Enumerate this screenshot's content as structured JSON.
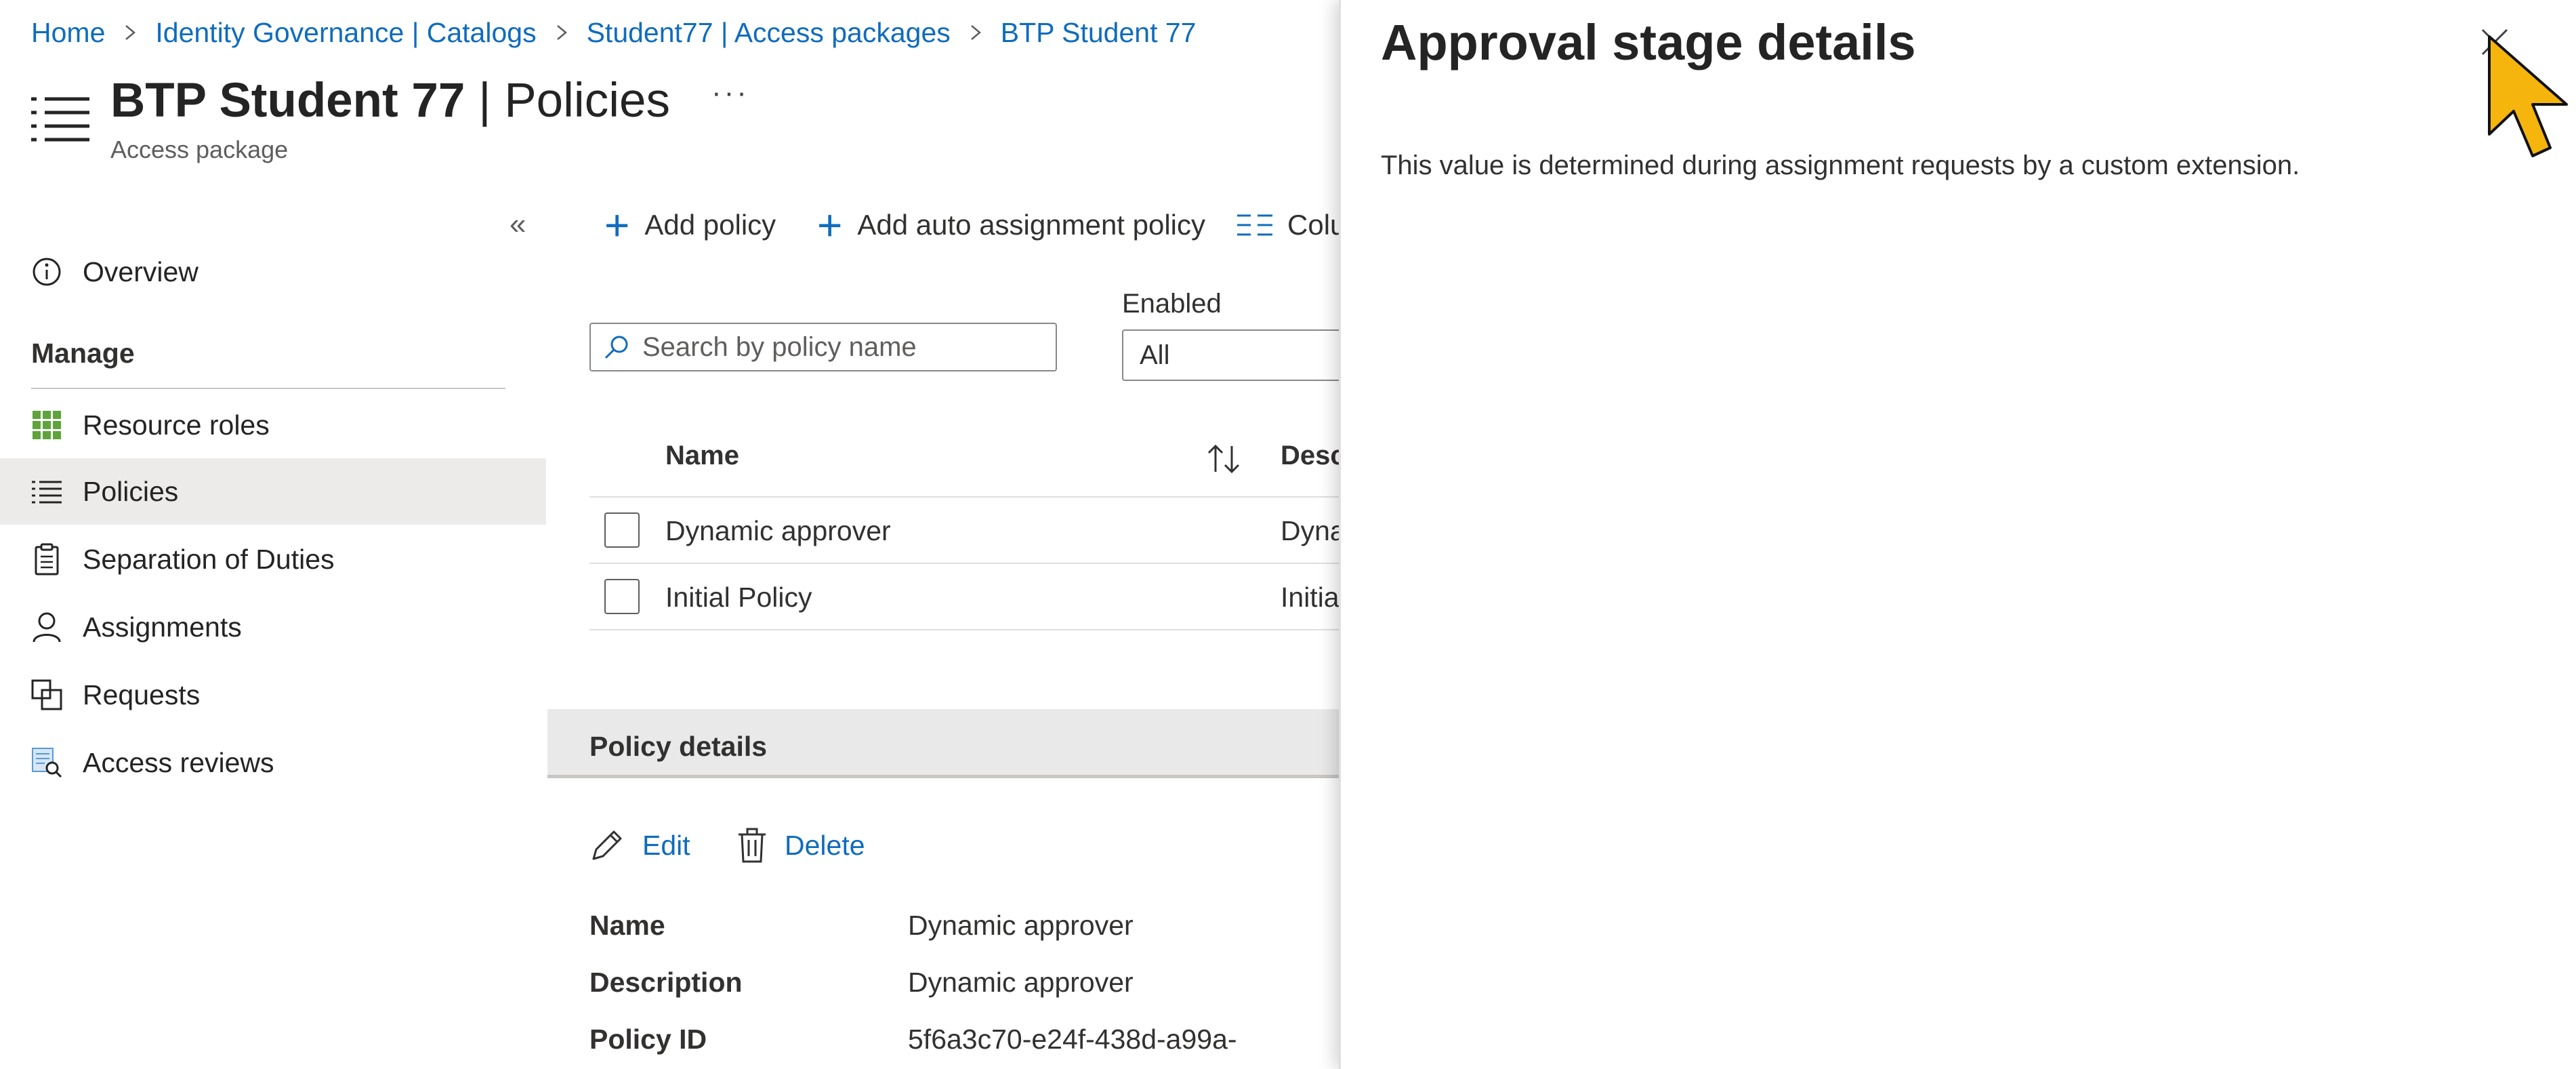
{
  "breadcrumb": [
    "Home",
    "Identity Governance | Catalogs",
    "Student77 | Access packages",
    "BTP Student 77"
  ],
  "header": {
    "title_name": "BTP Student 77",
    "title_separator": "|",
    "title_section": "Policies",
    "more": "···",
    "subtitle": "Access package"
  },
  "nav": {
    "collapse": "«",
    "overview": "Overview",
    "manage_label": "Manage",
    "items": [
      "Resource roles",
      "Policies",
      "Separation of Duties",
      "Assignments",
      "Requests",
      "Access reviews"
    ],
    "active": "Policies"
  },
  "toolbar": {
    "add_policy": "Add policy",
    "add_auto": "Add auto assignment policy",
    "columns": "Colu"
  },
  "filters": {
    "search_placeholder": "Search by policy name",
    "enabled_label": "Enabled",
    "enabled_value": "All"
  },
  "table": {
    "headers": [
      "Name",
      "Desc"
    ],
    "rows": [
      {
        "name": "Dynamic approver",
        "desc": "Dyna"
      },
      {
        "name": "Initial Policy",
        "desc": "Initia"
      }
    ]
  },
  "policy_details": {
    "title": "Policy details",
    "edit": "Edit",
    "delete": "Delete",
    "fields": [
      {
        "label": "Name",
        "value": "Dynamic approver"
      },
      {
        "label": "Description",
        "value": "Dynamic approver"
      },
      {
        "label": "Policy ID",
        "value": "5f6a3c70-e24f-438d-a99a-"
      }
    ]
  },
  "panel": {
    "title": "Approval stage details",
    "message": "This value is determined during assignment requests by a custom extension."
  },
  "colors": {
    "link": "#0f6cbd",
    "active_nav": "#edebe9",
    "cursor": "#f5b50d"
  }
}
